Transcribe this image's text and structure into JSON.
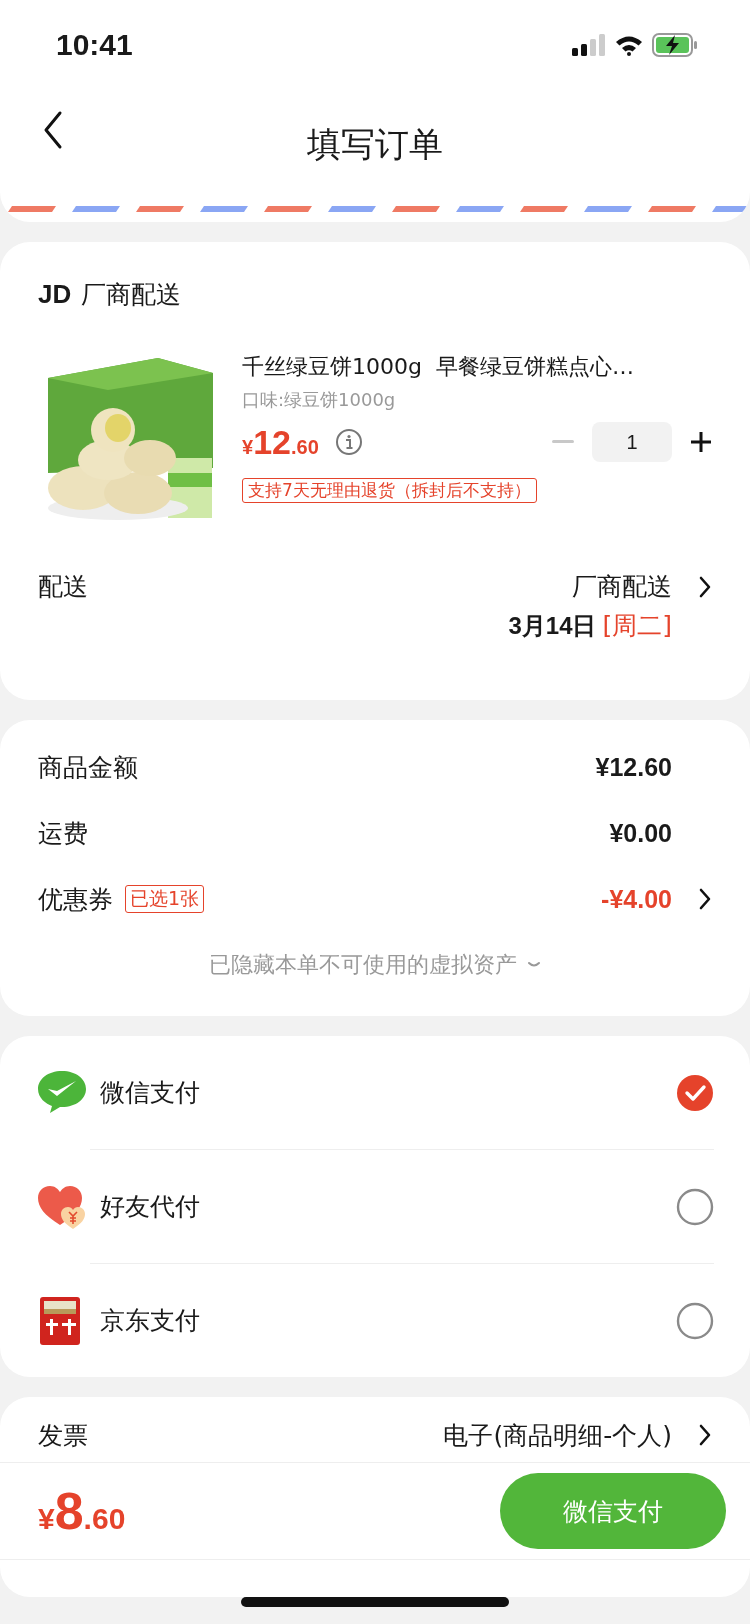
{
  "status_bar": {
    "time": "10:41"
  },
  "nav": {
    "title": "填写订单"
  },
  "shop": {
    "badge": "JD",
    "name": "厂商配送"
  },
  "product": {
    "title": "千丝绿豆饼1000g  早餐绿豆饼糕点心…",
    "spec": "口味:绿豆饼1000g",
    "price": {
      "symbol": "¥",
      "integer": "12",
      "decimal": ".60"
    },
    "quantity": "1",
    "return_policy": "支持7天无理由退货（拆封后不支持）"
  },
  "delivery": {
    "label": "配送",
    "method": "厂商配送",
    "date": "3月14日",
    "weekday": "[周二]"
  },
  "summary": [
    {
      "label": "商品金额",
      "value": "¥12.60",
      "highlight": false,
      "navigable": false
    },
    {
      "label": "运费",
      "value": "¥0.00",
      "highlight": false,
      "navigable": false
    },
    {
      "label": "优惠券",
      "tag": "已选1张",
      "value": "-¥4.00",
      "highlight": true,
      "navigable": true
    }
  ],
  "hidden_note": "已隐藏本单不可使用的虚拟资产",
  "payment_methods": [
    {
      "kind": "wechat",
      "label": "微信支付",
      "selected": true
    },
    {
      "kind": "friend",
      "label": "好友代付",
      "selected": false
    },
    {
      "kind": "jd",
      "label": "京东支付",
      "selected": false
    }
  ],
  "invoice": {
    "label": "发票",
    "value": "电子(商品明细-个人)"
  },
  "footer": {
    "total": {
      "symbol": "¥",
      "integer": "8",
      "decimal": ".60"
    },
    "pay_button": "微信支付"
  }
}
